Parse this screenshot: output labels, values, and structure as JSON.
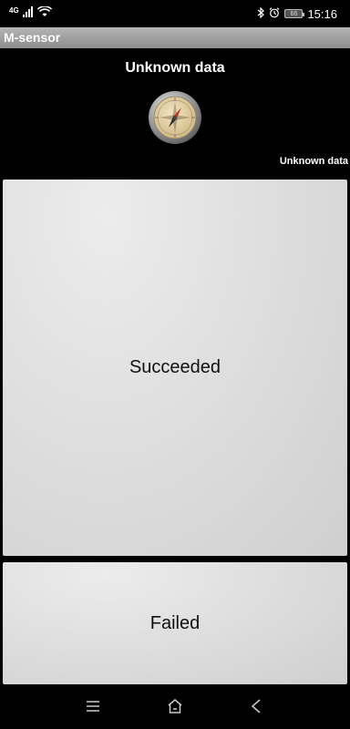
{
  "status_bar": {
    "network_label": "4G",
    "battery_level": "66",
    "time": "15:16"
  },
  "app_bar": {
    "title": "M-sensor"
  },
  "sensor": {
    "heading": "Unknown data",
    "value": "Unknown data",
    "icon": "compass-icon"
  },
  "actions": {
    "succeeded_label": "Succeeded",
    "failed_label": "Failed"
  },
  "nav_bar": {
    "menu_icon": "menu-icon",
    "home_icon": "home-icon",
    "back_icon": "back-icon"
  },
  "colors": {
    "background": "#000000",
    "button_bg": "#dcdcdc",
    "app_bar": "#a0a0a0"
  }
}
